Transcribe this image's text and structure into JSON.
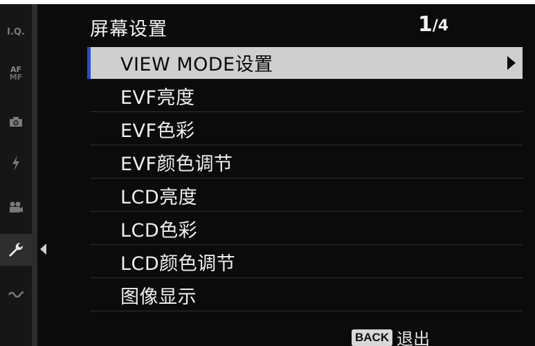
{
  "header": {
    "title": "屏幕设置",
    "page_current": "1",
    "page_total": "/4"
  },
  "sidebar": {
    "tabs": [
      {
        "id": "iq",
        "text": "I.Q."
      },
      {
        "id": "af-mf",
        "top": "AF",
        "bottom": "MF"
      },
      {
        "id": "camera",
        "icon": "camera-icon"
      },
      {
        "id": "flash",
        "icon": "flash-icon"
      },
      {
        "id": "movie",
        "icon": "movie-camera-icon"
      },
      {
        "id": "setup",
        "icon": "wrench-icon",
        "active": true
      },
      {
        "id": "connection",
        "icon": "wireless-icon"
      }
    ]
  },
  "menu": {
    "items": [
      {
        "label": "VIEW MODE设置",
        "selected": true
      },
      {
        "label": "EVF亮度"
      },
      {
        "label": "EVF色彩"
      },
      {
        "label": "EVF颜色调节"
      },
      {
        "label": "LCD亮度"
      },
      {
        "label": "LCD色彩"
      },
      {
        "label": "LCD颜色调节"
      },
      {
        "label": "图像显示"
      }
    ]
  },
  "footer": {
    "back_key": "BACK",
    "back_label": "退出"
  },
  "colors": {
    "accent": "#2550c8",
    "highlight": "#cfcfcf",
    "background": "#0b0b0b"
  }
}
